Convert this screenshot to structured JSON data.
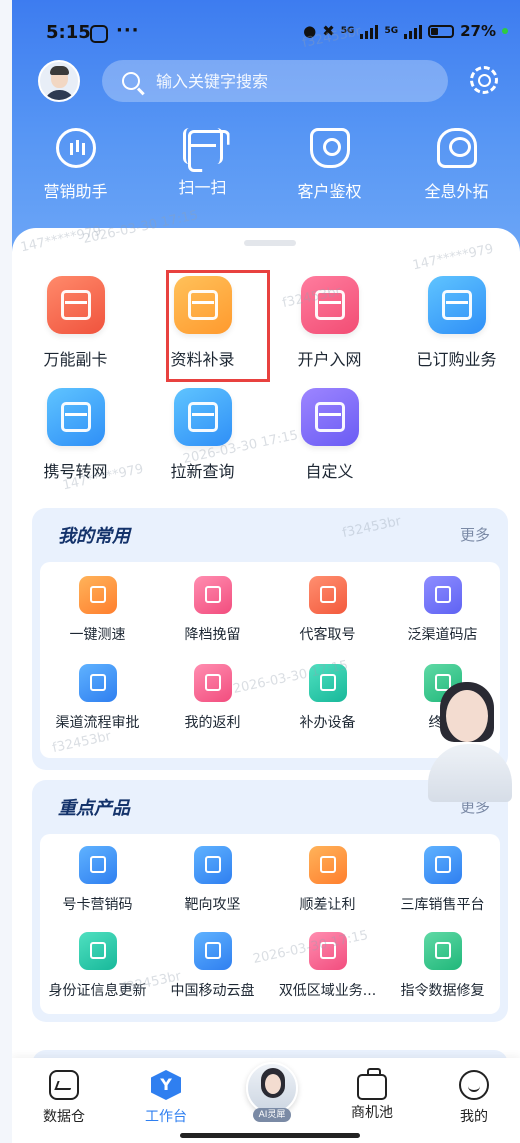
{
  "status_bar": {
    "time": "5:15",
    "more": "···",
    "net1": "5G",
    "net2": "5G",
    "battery": "27%"
  },
  "search": {
    "placeholder": "输入关键字搜索"
  },
  "quick_actions": [
    {
      "label": "营销助手",
      "icon": "chat-bubble-icon"
    },
    {
      "label": "扫一扫",
      "icon": "scan-icon"
    },
    {
      "label": "客户鉴权",
      "icon": "shield-user-icon"
    },
    {
      "label": "全息外拓",
      "icon": "user-badge-icon"
    }
  ],
  "main_grid": [
    {
      "label": "万能副卡",
      "icon": "card-icon",
      "color": "#f0533d"
    },
    {
      "label": "资料补录",
      "icon": "document-add-icon",
      "color": "#ff9a2e",
      "highlighted": true
    },
    {
      "label": "开户入网",
      "icon": "id-card-icon",
      "color": "#f24d74"
    },
    {
      "label": "已订购业务",
      "icon": "check-box-icon",
      "color": "#2f8ff7"
    },
    {
      "label": "携号转网",
      "icon": "phone-transfer-icon",
      "color": "#2f8ff7"
    },
    {
      "label": "拉新查询",
      "icon": "wallet-icon",
      "color": "#2f8ff7"
    },
    {
      "label": "自定义",
      "icon": "grid-plus-icon",
      "color": "#6a5cf4"
    }
  ],
  "favorites": {
    "title": "我的常用",
    "more": "更多",
    "items": [
      {
        "label": "一键测速",
        "icon": "lightning-icon"
      },
      {
        "label": "降档挽留",
        "icon": "chart-down-icon"
      },
      {
        "label": "代客取号",
        "icon": "ticket-icon"
      },
      {
        "label": "泛渠道码店",
        "icon": "store-icon"
      },
      {
        "label": "渠道流程审批",
        "icon": "rocket-icon"
      },
      {
        "label": "我的返利",
        "icon": "price-tag-icon"
      },
      {
        "label": "补办设备",
        "icon": "device-icon"
      },
      {
        "label": "终端",
        "icon": "terminal-icon"
      }
    ]
  },
  "key_products": {
    "title": "重点产品",
    "more": "更多",
    "items": [
      {
        "label": "号卡营销码",
        "icon": "sim-card-icon"
      },
      {
        "label": "靶向攻坚",
        "icon": "target-icon"
      },
      {
        "label": "顺差让利",
        "icon": "percent-icon"
      },
      {
        "label": "三库销售平台",
        "icon": "user-gear-icon"
      },
      {
        "label": "身份证信息更新",
        "icon": "id-card-icon"
      },
      {
        "label": "中国移动云盘",
        "icon": "cloud-icon"
      },
      {
        "label": "双低区域业务...",
        "icon": "location-down-icon"
      },
      {
        "label": "指令数据修复",
        "icon": "code-gear-icon"
      }
    ]
  },
  "ai_assistant": {
    "tag": "AI灵犀"
  },
  "tab_bar": [
    {
      "label": "数据仓",
      "icon": "chart-box-icon"
    },
    {
      "label": "工作台",
      "icon": "workbench-icon",
      "active": true
    },
    {
      "label": "商机池",
      "icon": "briefcase-icon"
    },
    {
      "label": "我的",
      "icon": "smile-icon"
    }
  ],
  "watermark": {
    "text1": "f32453br",
    "text2": "147*****979",
    "text3": "2026-03-30 17:15"
  }
}
